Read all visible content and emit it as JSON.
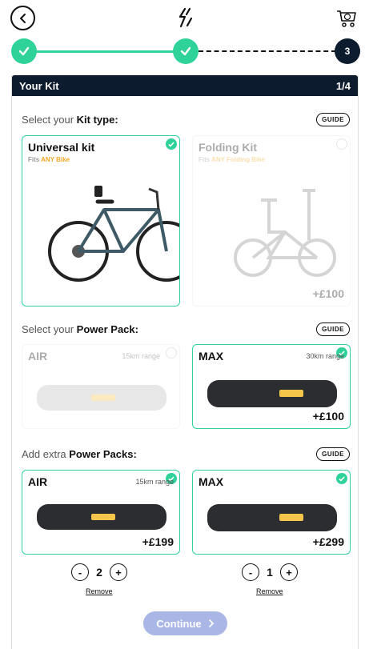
{
  "progress": {
    "steps": [
      "",
      "",
      "3"
    ]
  },
  "kit": {
    "header_title": "Your Kit",
    "header_page": "1/4",
    "kit_type": {
      "label_prefix": "Select your ",
      "label_bold": "Kit type:",
      "guide": "GUIDE",
      "options": [
        {
          "title": "Universal kit",
          "sub_prefix": "Fits ",
          "sub_highlight": "ANY Bike",
          "price": "",
          "selected": true
        },
        {
          "title": "Folding Kit",
          "sub_prefix": "Fits ",
          "sub_highlight": "ANY Folding Bike",
          "price": "+£100",
          "selected": false
        }
      ]
    },
    "power_pack": {
      "label_prefix": "Select your ",
      "label_bold": "Power Pack:",
      "guide": "GUIDE",
      "options": [
        {
          "title": "AIR",
          "range": "15km range",
          "price": "",
          "selected": false
        },
        {
          "title": "MAX",
          "range": "30km range",
          "price": "+£100",
          "selected": true
        }
      ]
    },
    "extra_packs": {
      "label_prefix": "Add extra ",
      "label_bold": "Power Packs:",
      "guide": "GUIDE",
      "options": [
        {
          "title": "AIR",
          "range": "15km range",
          "price": "+£199",
          "qty": "2",
          "remove": "Remove"
        },
        {
          "title": "MAX",
          "range": "",
          "price": "+£299",
          "qty": "1",
          "remove": "Remove"
        }
      ]
    },
    "stepper": {
      "minus": "-",
      "plus": "+"
    },
    "continue_label": "Continue"
  },
  "colors": {
    "accent": "#2fd39a",
    "navy": "#0d1b2e",
    "highlight": "#f5a623",
    "continue_bg": "#a9b6e6"
  }
}
